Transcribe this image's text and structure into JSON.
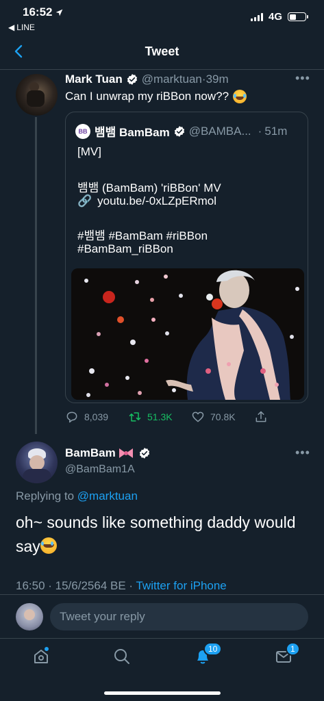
{
  "status_bar": {
    "time": "16:52",
    "back_app": "LINE",
    "network": "4G"
  },
  "header": {
    "title": "Tweet"
  },
  "tweet1": {
    "name": "Mark Tuan",
    "handle": "@marktuan",
    "time": "39m",
    "text": "Can I unwrap my riBBon now??"
  },
  "quote": {
    "name": "뱀뱀 BamBam",
    "handle": "@BAMBA...",
    "time": "51m",
    "line1": "[MV]",
    "line2": "뱀뱀 (BamBam) 'riBBon' MV",
    "line3": "youtu.be/-0xLZpERmol",
    "line4": "#뱀뱀 #BamBam #riBBon",
    "line5": "#BamBam_riBBon"
  },
  "actions": {
    "replies": "8,039",
    "retweets": "51.3K",
    "likes": "70.8K"
  },
  "tweet2": {
    "name": "BamBam",
    "handle": "@BamBam1A",
    "replying_label": "Replying to",
    "replying_to": "@marktuan",
    "text": "oh~ sounds like something daddy would say",
    "timestamp": "16:50 · 15/6/2564 BE · ",
    "source": "Twitter for iPhone"
  },
  "reply_bar": {
    "placeholder": "Tweet your reply"
  },
  "tabbar": {
    "notifications_badge": "10",
    "messages_badge": "1"
  },
  "colors": {
    "background": "#15202b",
    "accent": "#1da1f2",
    "retweet": "#17bf63",
    "muted": "#8899a6"
  },
  "icons": [
    "location-arrow-icon",
    "back-chevron-icon",
    "verified-badge-icon",
    "more-icon",
    "reply-icon",
    "retweet-icon",
    "like-icon",
    "share-icon",
    "ribbon-emoji-icon",
    "home-icon",
    "search-icon",
    "bell-icon",
    "mail-icon"
  ]
}
